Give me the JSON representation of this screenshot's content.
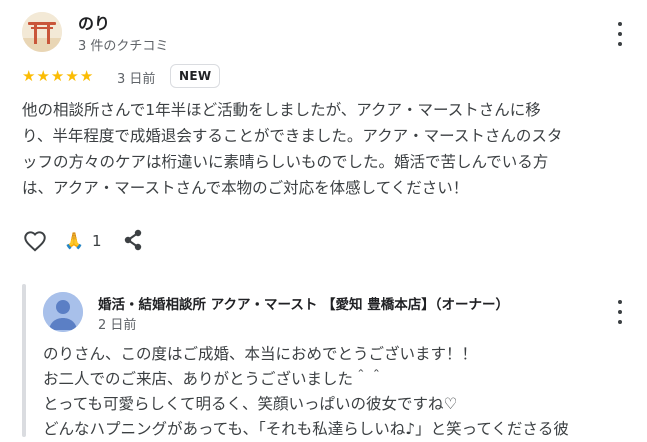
{
  "review": {
    "author_name": "のり",
    "author_meta": "3 件のクチコミ",
    "rating": 5,
    "stars": [
      "★",
      "★",
      "★",
      "★",
      "★"
    ],
    "date": "3 日前",
    "badge": "NEW",
    "text_lines": [
      "他の相談所さんで1年半ほど活動をしましたが、アクア・マーストさんに移",
      "り、半年程度で成婚退会することができました。アクア・マーストさんのスタ",
      "ッフの方々のケアは桁違いに素晴らしいものでした。婚活で苦しんでいる方",
      "は、アクア・マーストさんで本物のご対応を体感してください！"
    ],
    "pray_emoji": "🙏",
    "reaction_count": "1",
    "icons": [
      "heart-icon",
      "praying-hands-icon",
      "share-icon",
      "more-vert-icon"
    ]
  },
  "owner_reply": {
    "name": "婚活・結婚相談所 アクア・マースト 【愛知 豊橋本店】（オーナー）",
    "date": "2 日前",
    "text_lines": [
      "のりさん、この度はご成婚、本当におめでとうございます！！",
      "お二人でのご来店、ありがとうございました＾＾",
      "とっても可愛らしくて明るく、笑顔いっぱいの彼女ですね♡",
      "どんなハプニングがあっても、「それも私達らしいね♪」と笑ってくださる彼"
    ]
  },
  "colors": {
    "star": "#fbbc04",
    "text": "#3c4043",
    "secondary": "#5f6368",
    "divider": "#dadce0"
  }
}
